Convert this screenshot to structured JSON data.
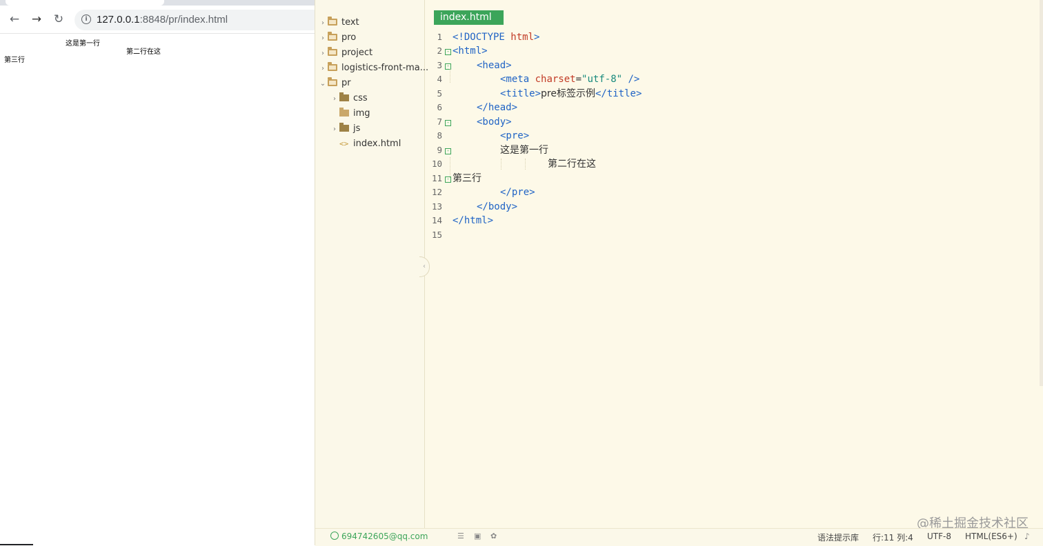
{
  "browser": {
    "url_host": "127.0.0.1",
    "url_rest": ":8848/pr/index.html",
    "nav": {
      "back": "←",
      "forward": "→",
      "reload": "↻"
    }
  },
  "preview": {
    "line1": "这是第一行",
    "line2": "第二行在这",
    "line3": "第三行"
  },
  "file_tree": [
    {
      "label": "text",
      "type": "folder",
      "expanded": false
    },
    {
      "label": "pro",
      "type": "folder",
      "expanded": false
    },
    {
      "label": "project",
      "type": "folder",
      "expanded": false
    },
    {
      "label": "logistics-front-ma...",
      "type": "folder",
      "expanded": false
    },
    {
      "label": "pr",
      "type": "folder",
      "expanded": true
    },
    {
      "label": "css",
      "type": "folder",
      "expanded": false
    },
    {
      "label": "img",
      "type": "folder",
      "expanded": false
    },
    {
      "label": "js",
      "type": "folder",
      "expanded": false
    },
    {
      "label": "index.html",
      "type": "file"
    }
  ],
  "editor": {
    "active_tab": "index.html",
    "line_numbers": [
      "1",
      "2",
      "3",
      "4",
      "5",
      "6",
      "7",
      "8",
      "9",
      "10",
      "11",
      "12",
      "13",
      "14",
      "15"
    ],
    "code": {
      "l1_open": "<!DOCTYPE",
      "l1_kw": "html",
      "l1_close": ">",
      "l2": "<html>",
      "l3": "<head>",
      "l4_tag": "<meta",
      "l4_attr": "charset",
      "l4_eq": "=",
      "l4_val": "\"utf-8\"",
      "l4_close": "/>",
      "l5_open": "<title>",
      "l5_text": "pre标签示例",
      "l5_close": "</title>",
      "l6": "</head>",
      "l7": "<body>",
      "l8": "<pre>",
      "l9": "这是第一行",
      "l10": "第二行在这",
      "l11": "第三行",
      "l12": "</pre>",
      "l13": "</body>",
      "l14": "</html>"
    }
  },
  "status_bar": {
    "user": "694742605@qq.com",
    "syntax_hint": "语法提示库",
    "position": "行:11  列:4",
    "encoding": "UTF-8",
    "language": "HTML(ES6+)"
  },
  "watermark": "@稀土掘金技术社区",
  "colors": {
    "accent_green": "#3ca55a",
    "editor_bg": "#fdf9e8",
    "tag_blue": "#1f63c5",
    "attr_red": "#c23b26",
    "string_teal": "#17897c"
  }
}
